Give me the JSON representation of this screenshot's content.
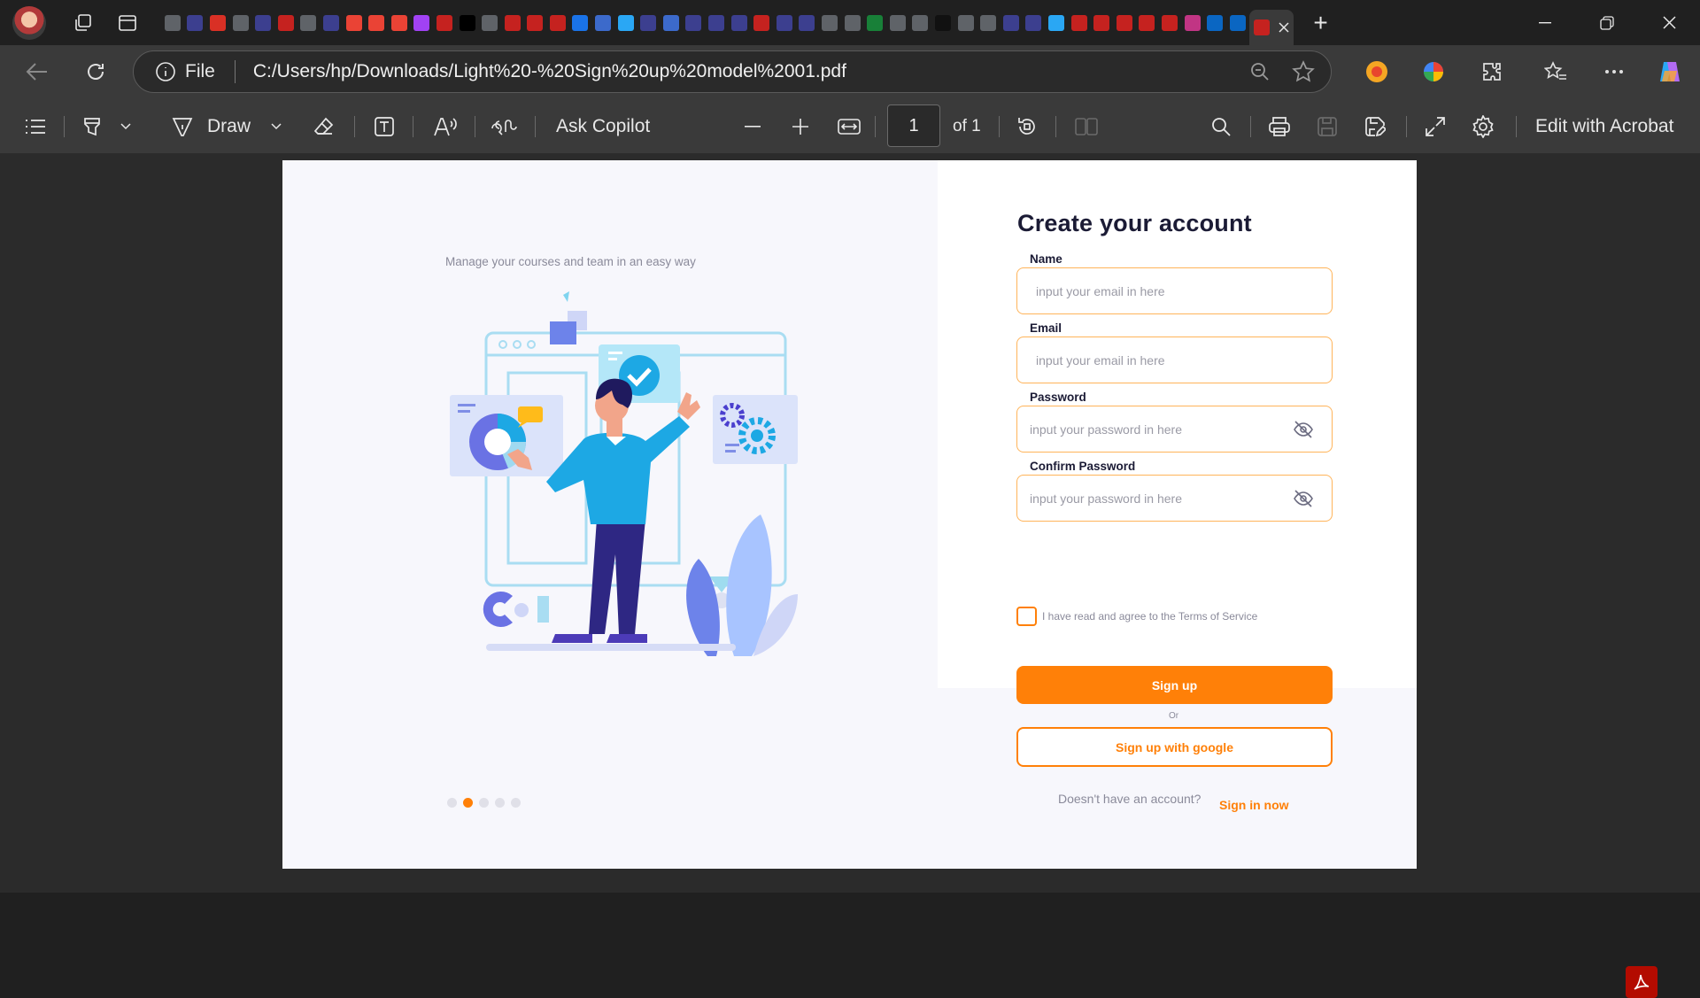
{
  "browser": {
    "tabs_count_label": "",
    "active_tab": {
      "icon": "pdf-icon"
    },
    "window_controls": [
      "minimize-icon",
      "restore-icon",
      "close-icon"
    ]
  },
  "address": {
    "scheme_label": "File",
    "url": "C:/Users/hp/Downloads/Light%20-%20Sign%20up%20model%2001.pdf"
  },
  "pdf_toolbar": {
    "draw_label": "Draw",
    "copilot_label": "Ask Copilot",
    "page_current": "1",
    "page_total_label": "of 1",
    "acrobat_label": "Edit with Acrobat"
  },
  "document": {
    "tagline": "Manage your courses and team in an easy way",
    "title": "Create your account",
    "fields": [
      {
        "label": "Name",
        "placeholder": "input your email in here"
      },
      {
        "label": "Email",
        "placeholder": "input your email in here"
      },
      {
        "label": "Password",
        "placeholder": "input your password in here"
      },
      {
        "label": "Confirm Password",
        "placeholder": "input your password in here"
      }
    ],
    "terms": "I have read and agree to the Terms of Service",
    "signup_label": "Sign up",
    "or_label": "Or",
    "google_label": "Sign up with google",
    "no_account": "Doesn't have an account?",
    "signin_label": "Sign in now",
    "carousel_active_index": 1,
    "carousel_count": 5
  },
  "colors": {
    "accent": "#ff8008",
    "title": "#1b1b35",
    "panel": "#f7f7fc"
  }
}
